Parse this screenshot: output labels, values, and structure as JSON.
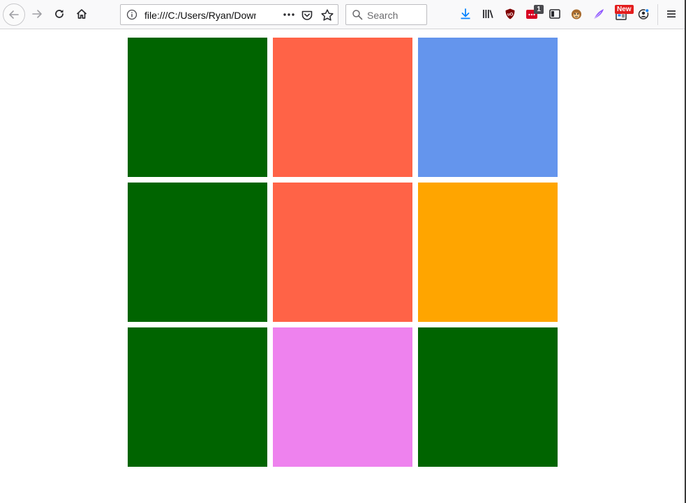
{
  "browser": {
    "url": "file:///C:/Users/Ryan/Downloads/index.html",
    "search_placeholder": "Search",
    "notification_badge": "1",
    "new_badge": "New",
    "accent_color": "#0a84ff"
  },
  "tiles": [
    {
      "color": "#006400"
    },
    {
      "color": "#ff6347"
    },
    {
      "color": "#6495ed"
    },
    {
      "color": "#006400"
    },
    {
      "color": "#ff6347"
    },
    {
      "color": "#ffa500"
    },
    {
      "color": "#006400"
    },
    {
      "color": "#ee82ee"
    },
    {
      "color": "#006400"
    }
  ]
}
